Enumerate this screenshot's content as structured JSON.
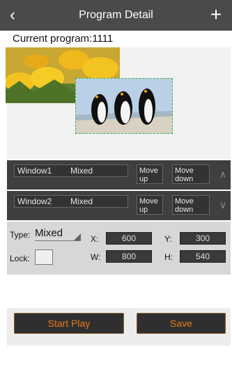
{
  "header": {
    "title": "Program Detail",
    "back_icon": "chevron-left-icon",
    "add_icon": "plus-icon"
  },
  "current_program": "Current program:1111",
  "windows": [
    {
      "name": "Window1",
      "type": "Mixed",
      "move_up": "Move up",
      "move_down": "Move down"
    },
    {
      "name": "Window2",
      "type": "Mixed",
      "move_up": "Move up",
      "move_down": "Move down"
    }
  ],
  "props": {
    "type_label": "Type:",
    "type_value": "Mixed",
    "lock_label": "Lock:",
    "x_label": "X:",
    "x_value": "600",
    "y_label": "Y:",
    "y_value": "300",
    "w_label": "W:",
    "w_value": "800",
    "h_label": "H:",
    "h_value": "540"
  },
  "actions": {
    "start_play": "Start Play",
    "save": "Save"
  },
  "colors": {
    "header_bg": "#4a4a4a",
    "accent_text": "#e8791e",
    "selection_border": "#3cb24a"
  }
}
